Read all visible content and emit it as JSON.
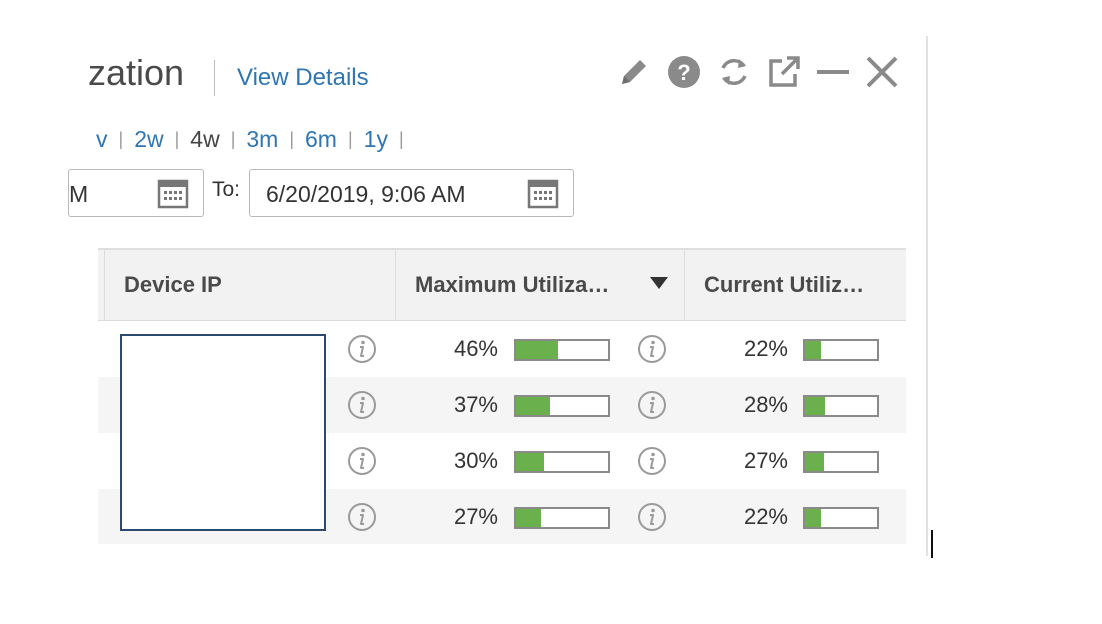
{
  "header": {
    "title_partial": "zation",
    "view_details": "View Details"
  },
  "toolbar": {
    "icons": [
      "pencil-icon",
      "help-icon",
      "refresh-icon",
      "external-link-icon",
      "minimize-icon",
      "close-icon"
    ]
  },
  "time_ranges": [
    {
      "label": "v",
      "active": false
    },
    {
      "label": "2w",
      "active": false
    },
    {
      "label": "4w",
      "active": true
    },
    {
      "label": "3m",
      "active": false
    },
    {
      "label": "6m",
      "active": false
    },
    {
      "label": "1y",
      "active": false
    }
  ],
  "date_range": {
    "from_partial": "M",
    "to_label": "To:",
    "to_value": "6/20/2019, 9:06 AM"
  },
  "table": {
    "columns": {
      "device_ip": "Device IP",
      "max_util": "Maximum Utiliza…",
      "current_util": "Current Utiliz…"
    },
    "rows": [
      {
        "max": "46%",
        "max_frac": 0.46,
        "cur": "22%",
        "cur_frac": 0.22
      },
      {
        "max": "37%",
        "max_frac": 0.37,
        "cur": "28%",
        "cur_frac": 0.28
      },
      {
        "max": "30%",
        "max_frac": 0.3,
        "cur": "27%",
        "cur_frac": 0.27
      },
      {
        "max": "27%",
        "max_frac": 0.27,
        "cur": "22%",
        "cur_frac": 0.22
      }
    ]
  },
  "colors": {
    "link": "#2e76b3",
    "bar_fill": "#6ab04c",
    "mask_border": "#2a4a70"
  }
}
